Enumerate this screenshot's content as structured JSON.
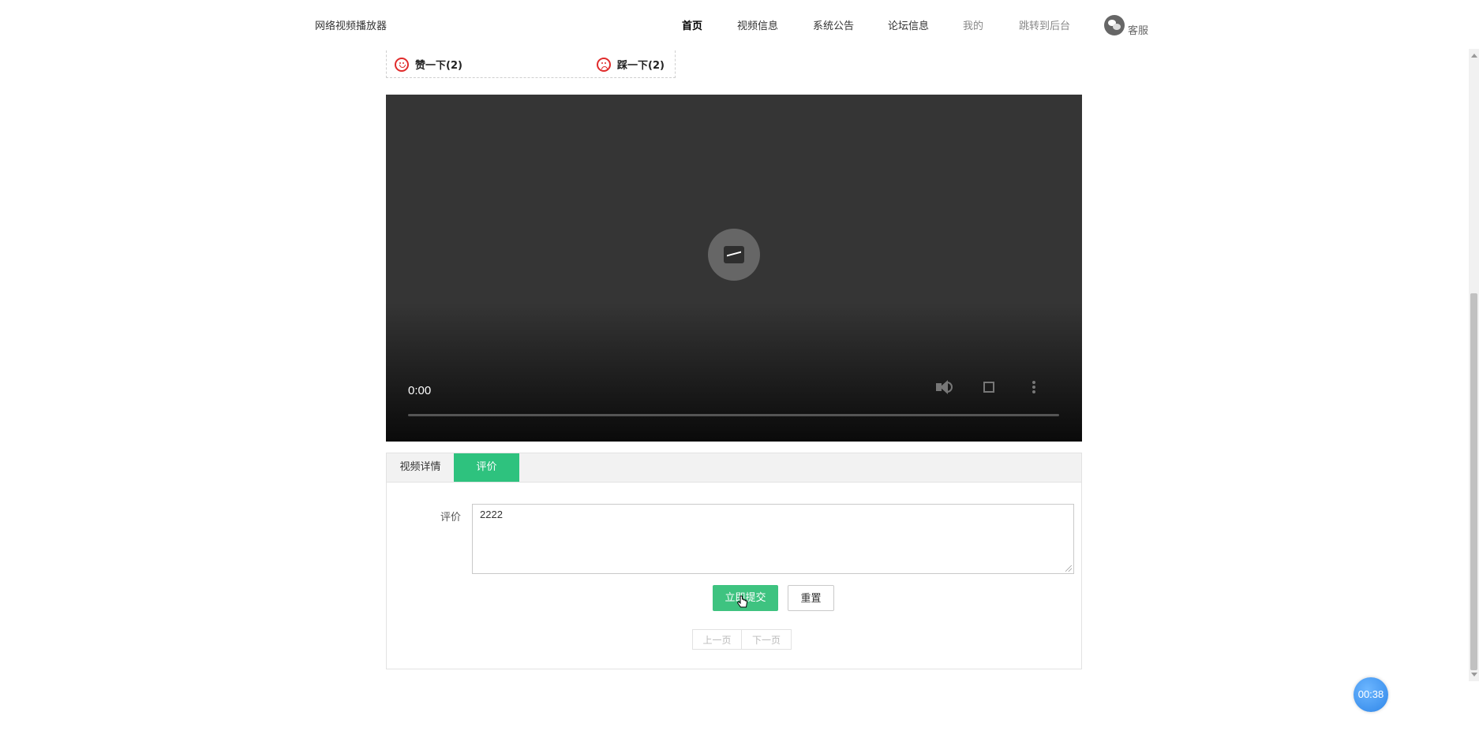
{
  "header": {
    "brand": "网络视频播放器",
    "nav": [
      "首页",
      "视频信息",
      "系统公告",
      "论坛信息",
      "我的",
      "跳转到后台"
    ],
    "customer_service": "客服",
    "customer_service_icon": "wechat-icon"
  },
  "votes": {
    "like_label": "赞一下(2)",
    "dislike_label": "踩一下(2)",
    "like_icon": "smile-icon",
    "dislike_icon": "frown-icon",
    "accent_color": "#e02b2b"
  },
  "player": {
    "current_time": "0:00",
    "progress": 0
  },
  "tabs": {
    "items": [
      "视频详情",
      "评价"
    ],
    "active_index": 1,
    "active_color": "#2ec27e"
  },
  "comment_form": {
    "label": "评价",
    "value": "2222",
    "submit_label": "立即提交",
    "reset_label": "重置"
  },
  "pagination": {
    "prev": "上一页",
    "next": "下一页"
  },
  "timer": {
    "value": "00:38"
  }
}
